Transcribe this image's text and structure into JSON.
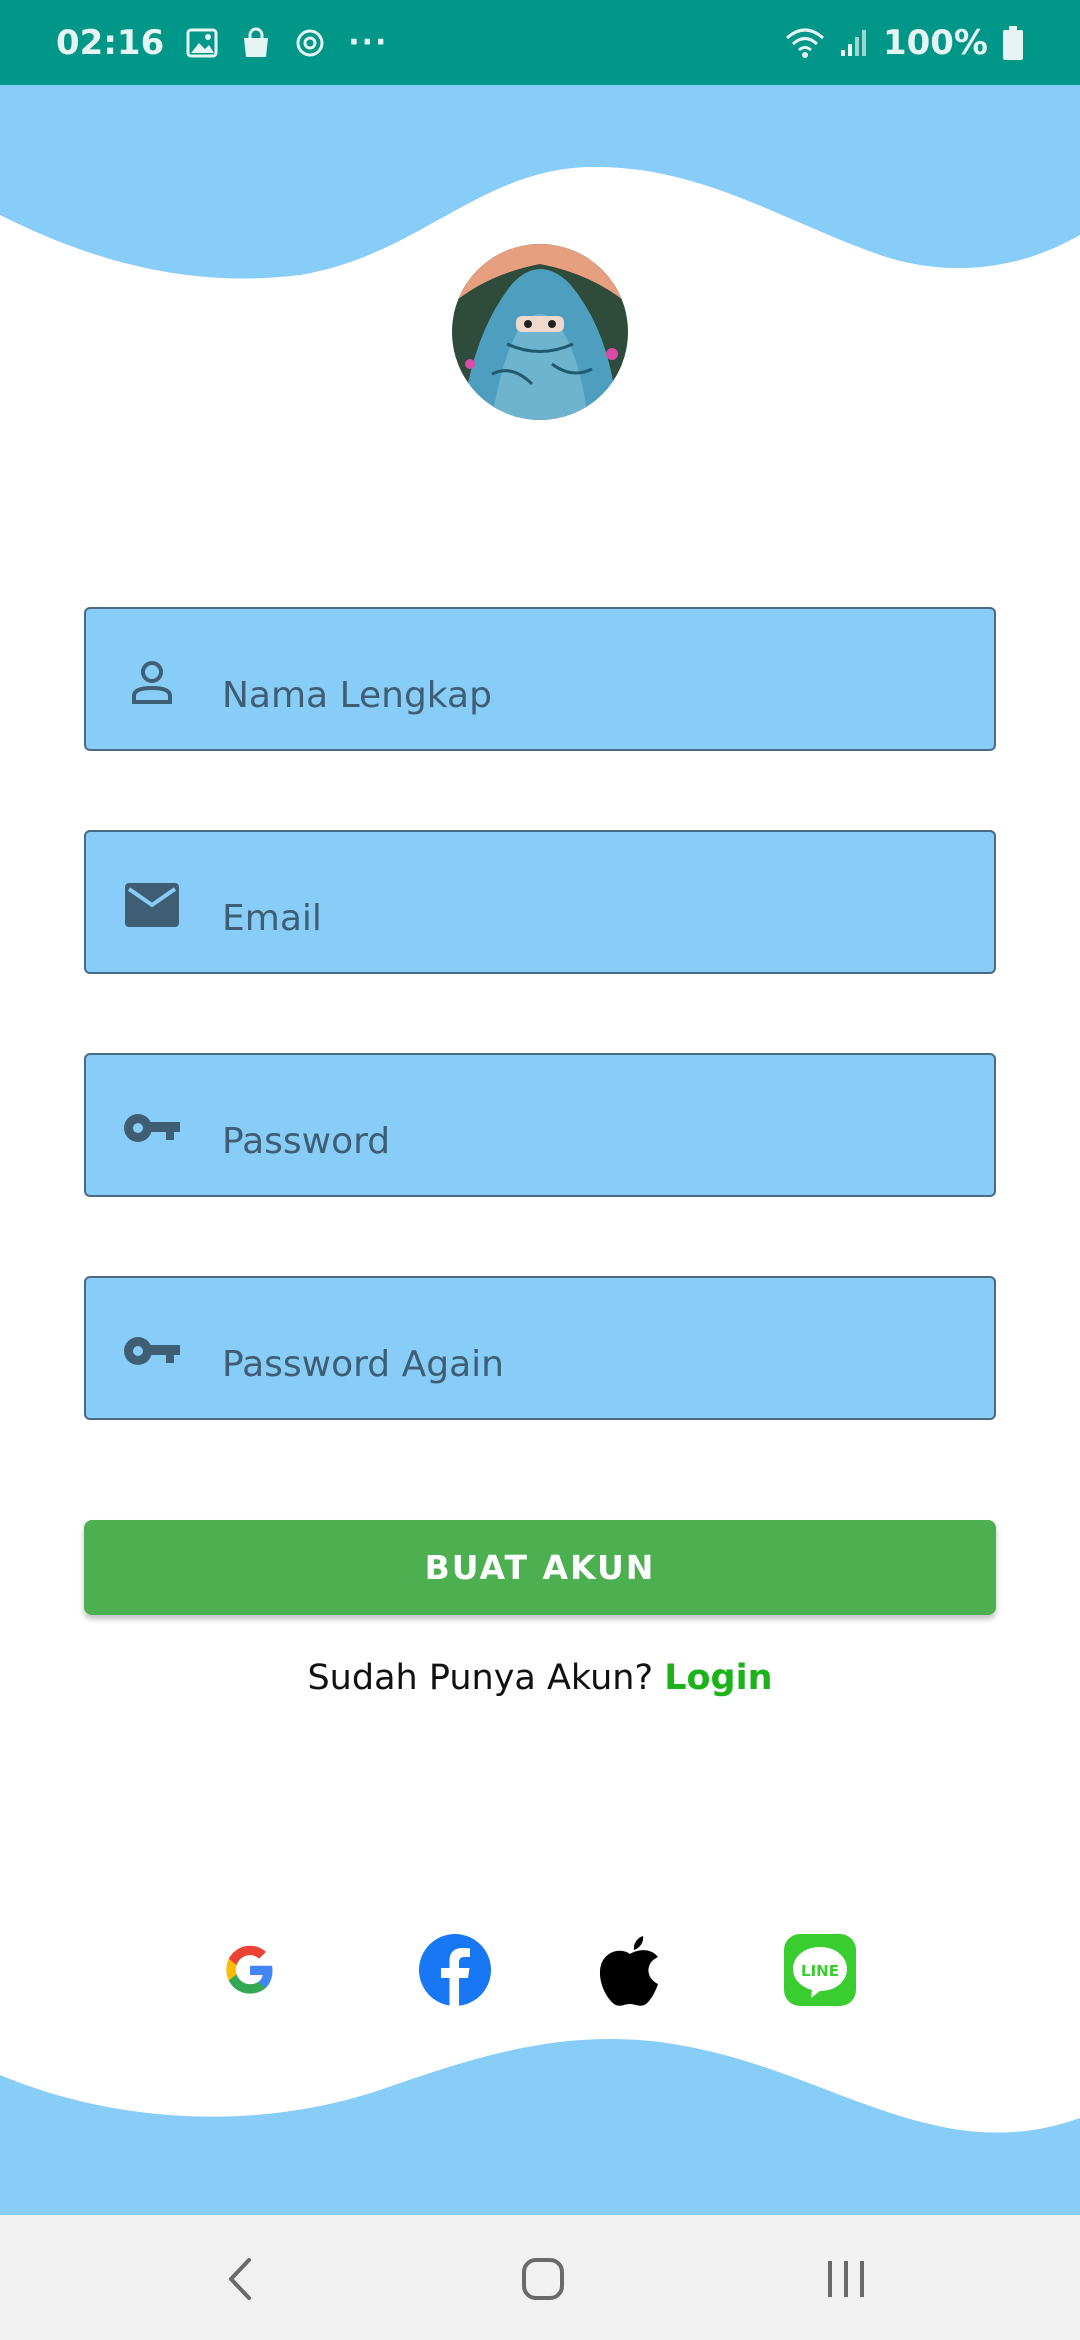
{
  "status_bar": {
    "time": "02:16",
    "battery": "100%",
    "icons": [
      "image-icon",
      "bag-icon",
      "sync-icon",
      "more-icon",
      "wifi-icon",
      "signal-icon",
      "battery-icon"
    ],
    "overflow": "···"
  },
  "colors": {
    "status_bar": "#009688",
    "wave": "#88cdf8",
    "field_bg": "#88cdf8",
    "button_bg": "#4caf50",
    "link": "#1ab31a"
  },
  "form": {
    "name_placeholder": "Nama Lengkap",
    "name_icon": "person-icon",
    "email_placeholder": "Email",
    "email_icon": "mail-icon",
    "password_placeholder": "Password",
    "password_icon": "key-icon",
    "password_again_placeholder": "Password Again",
    "password_again_icon": "key-icon"
  },
  "button": {
    "label": "BUAT AKUN"
  },
  "login_prompt": {
    "text": "Sudah Punya Akun? ",
    "link": "Login"
  },
  "social": [
    "google-icon",
    "facebook-icon",
    "apple-icon",
    "line-icon"
  ],
  "line_icon_text": "LINE",
  "nav": [
    "back-icon",
    "home-icon",
    "recents-icon"
  ]
}
